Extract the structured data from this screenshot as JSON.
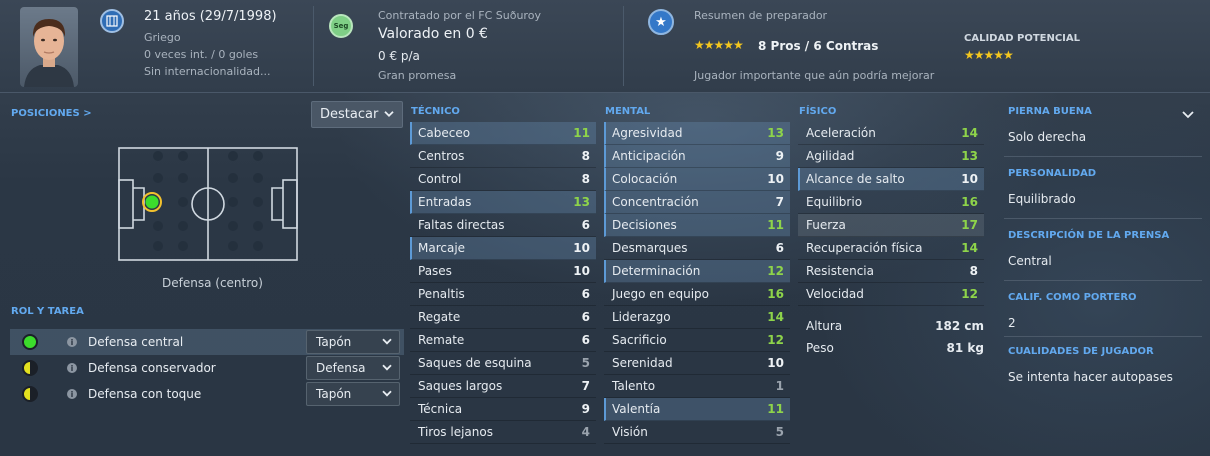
{
  "header": {
    "age": "21 años (29/7/1998)",
    "nationality": "Griego",
    "caps": "0 veces int. / 0 goles",
    "intl_status": "Sin internacionalidad...",
    "contract_club": "Contratado por el FC Suðuroy",
    "value": "Valorado en 0 €",
    "wage": "0 € p/a",
    "status_label": "Gran promesa",
    "seg_badge": "Seg",
    "scout_title": "Resumen de preparador",
    "scout_stars": "★★★★★",
    "pros_cons": "8 Pros / 6 Contras",
    "scout_summary": "Jugador importante que aún podría mejorar",
    "potential_caption": "CALIDAD POTENCIAL",
    "potential_stars": "★★★★★"
  },
  "positions": {
    "title": "POSICIONES >",
    "dropdown": "Destacar",
    "position_label": "Defensa (centro)"
  },
  "roles": {
    "title": "ROL Y TAREA",
    "items": [
      {
        "name": "Defensa central",
        "duty": "Tapón"
      },
      {
        "name": "Defensa conservador",
        "duty": "Defensa"
      },
      {
        "name": "Defensa con toque",
        "duty": "Tapón"
      }
    ]
  },
  "technical": {
    "title": "TÉCNICO",
    "rows": [
      {
        "name": "Cabeceo",
        "value": "11"
      },
      {
        "name": "Centros",
        "value": "8"
      },
      {
        "name": "Control",
        "value": "8"
      },
      {
        "name": "Entradas",
        "value": "13"
      },
      {
        "name": "Faltas directas",
        "value": "6"
      },
      {
        "name": "Marcaje",
        "value": "10"
      },
      {
        "name": "Pases",
        "value": "10"
      },
      {
        "name": "Penaltis",
        "value": "6"
      },
      {
        "name": "Regate",
        "value": "6"
      },
      {
        "name": "Remate",
        "value": "6"
      },
      {
        "name": "Saques de esquina",
        "value": "5"
      },
      {
        "name": "Saques largos",
        "value": "7"
      },
      {
        "name": "Técnica",
        "value": "9"
      },
      {
        "name": "Tiros lejanos",
        "value": "4"
      }
    ]
  },
  "mental": {
    "title": "MENTAL",
    "rows": [
      {
        "name": "Agresividad",
        "value": "13"
      },
      {
        "name": "Anticipación",
        "value": "9"
      },
      {
        "name": "Colocación",
        "value": "10"
      },
      {
        "name": "Concentración",
        "value": "7"
      },
      {
        "name": "Decisiones",
        "value": "11"
      },
      {
        "name": "Desmarques",
        "value": "6"
      },
      {
        "name": "Determinación",
        "value": "12"
      },
      {
        "name": "Juego en equipo",
        "value": "16"
      },
      {
        "name": "Liderazgo",
        "value": "14"
      },
      {
        "name": "Sacrificio",
        "value": "12"
      },
      {
        "name": "Serenidad",
        "value": "10"
      },
      {
        "name": "Talento",
        "value": "1"
      },
      {
        "name": "Valentía",
        "value": "11"
      },
      {
        "name": "Visión",
        "value": "5"
      }
    ]
  },
  "physical": {
    "title": "FÍSICO",
    "rows": [
      {
        "name": "Aceleración",
        "value": "14"
      },
      {
        "name": "Agilidad",
        "value": "13"
      },
      {
        "name": "Alcance de salto",
        "value": "10"
      },
      {
        "name": "Equilibrio",
        "value": "16"
      },
      {
        "name": "Fuerza",
        "value": "17"
      },
      {
        "name": "Recuperación física",
        "value": "14"
      },
      {
        "name": "Resistencia",
        "value": "8"
      },
      {
        "name": "Velocidad",
        "value": "12"
      }
    ],
    "height_label": "Altura",
    "height_value": "182 cm",
    "weight_label": "Peso",
    "weight_value": "81 kg"
  },
  "info": {
    "foot_title": "PIERNA BUENA",
    "foot_value": "Solo derecha",
    "personality_title": "PERSONALIDAD",
    "personality_value": "Equilibrado",
    "press_title": "DESCRIPCIÓN DE LA PRENSA",
    "press_value": "Central",
    "gk_title": "CALIF. COMO PORTERO",
    "gk_value": "2",
    "traits_title": "CUALIDADES DE JUGADOR",
    "traits_value": "Se intenta hacer autopases"
  },
  "colors": {
    "accent": "#62a9ef",
    "green_value": "#8ed44a",
    "role_green": "#3cdc2c",
    "role_yellow": "#e3e11f",
    "star": "#f3c61f"
  }
}
